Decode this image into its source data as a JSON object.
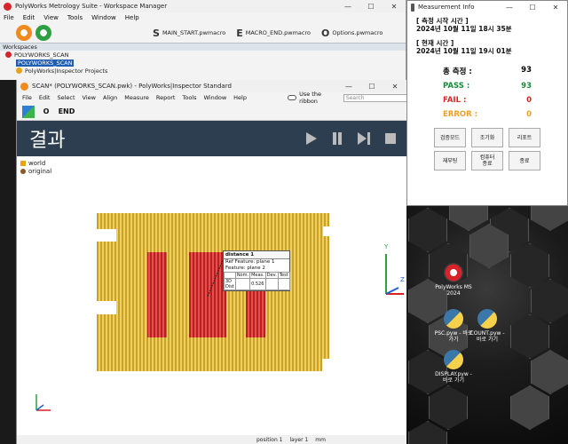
{
  "workspace_manager": {
    "title": "PolyWorks Metrology Suite - Workspace Manager",
    "menu": [
      "File",
      "Edit",
      "View",
      "Tools",
      "Window",
      "Help"
    ],
    "macros": [
      {
        "letter": "S",
        "label": "MAIN_START.pwmacro"
      },
      {
        "letter": "E",
        "label": "MACRO_END.pwmacro"
      },
      {
        "letter": "O",
        "label": "Options.pwmacro"
      }
    ],
    "panel_title": "Workspaces",
    "tree": [
      "POLYWORKS_SCAN",
      "POLYWORKS_SCAN",
      "PolyWorks|Inspector Projects"
    ]
  },
  "inspector": {
    "title": "SCAN* (POLYWORKS_SCAN.pwk) - PolyWorks|Inspector Standard",
    "menu": [
      "File",
      "Edit",
      "Select",
      "View",
      "Align",
      "Measure",
      "Report",
      "Tools",
      "Window",
      "Help"
    ],
    "ribbon_label": "Use the ribbon",
    "search_placeholder": "Search",
    "tool_labels": [
      "O",
      "END"
    ],
    "banner_title": "결과",
    "legend": [
      {
        "label": "world",
        "color": "#e8a317"
      },
      {
        "label": "original",
        "color": "#8b5a2b"
      }
    ],
    "tooltip": {
      "title": "distance 1",
      "ref_feature": "Ref Feature: plane 1",
      "feature": "Feature: plane 2",
      "headers": [
        "",
        "Nom.",
        "Meas.",
        "Dev.",
        "Test"
      ],
      "row": [
        "3D Dist",
        "",
        "0.526",
        "",
        ""
      ]
    },
    "axes": {
      "x": "X",
      "y": "Y",
      "z": "Z"
    },
    "status": [
      "position 1",
      "layer 1",
      "mm"
    ]
  },
  "measurement_info": {
    "title": "Measurement Info",
    "start_label": "[ 측정 시작 시간 ]",
    "start_time": "2024년 10월 11일 18시 35분",
    "now_label": "[ 현재 시간 ]",
    "now_time": "2024년 10월 11일 19시 01분",
    "stats": [
      {
        "label": "총 측정 :",
        "value": "93",
        "color": "#111111"
      },
      {
        "label": "PASS :",
        "value": "93",
        "color": "#1a8a3a"
      },
      {
        "label": "FAIL :",
        "value": "0",
        "color": "#e02424"
      },
      {
        "label": "ERROR :",
        "value": "0",
        "color": "#f0a020"
      }
    ],
    "buttons": [
      "검증모드",
      "조기화",
      "리포트",
      "재부팅",
      "컴퓨터\n종료",
      "종료"
    ]
  },
  "desktop": {
    "icons": [
      "PolyWorks MS 2024",
      "PSC.pyw - 바로 가기",
      "COUNT.pyw - 바로 가기",
      "DISPLAY.pyw - 바로 가기"
    ]
  }
}
